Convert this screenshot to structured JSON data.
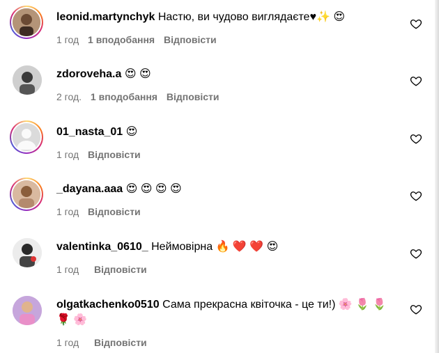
{
  "comments": [
    {
      "username": "leonid.martynchyk",
      "text": "Настю, ви чудово виглядаєте♥✨ 😍",
      "time": "1 год",
      "likes": "1 вподобання",
      "reply": "Відповісти"
    },
    {
      "username": "zdoroveha.a",
      "text": "😍 😍",
      "time": "2 год.",
      "likes": "1 вподобання",
      "reply": "Відповісти"
    },
    {
      "username": "01_nasta_01",
      "text": "😍",
      "time": "1 год",
      "likes": "",
      "reply": "Відповісти"
    },
    {
      "username": "_dayana.aaa",
      "text": "😍 😍 😍 😍",
      "time": "1 год",
      "likes": "",
      "reply": "Відповісти"
    },
    {
      "username": "valentinka_0610_",
      "text": "Неймовірна 🔥 ❤️ ❤️ 😍",
      "time": "1 год",
      "likes": "",
      "reply": "Відповісти"
    },
    {
      "username": "olgatkachenko0510",
      "text": "Сама прекрасна квіточка - це ти!) 🌸 🌷 🌷 🌹 🌸",
      "time": "1 год",
      "likes": "",
      "reply": "Відповісти"
    }
  ]
}
